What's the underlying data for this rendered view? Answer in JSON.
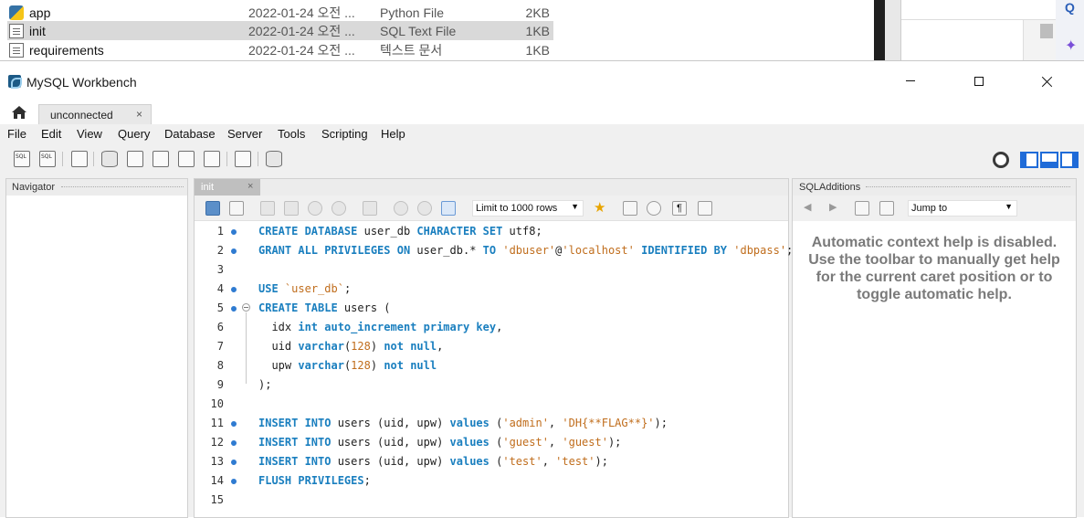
{
  "explorer": {
    "files": [
      {
        "name": "app",
        "date": "2022-01-24 오전 ...",
        "type": "Python File",
        "size": "2KB",
        "icon": "python-file-icon"
      },
      {
        "name": "init",
        "date": "2022-01-24 오전 ...",
        "type": "SQL Text File",
        "size": "1KB",
        "icon": "document-icon"
      },
      {
        "name": "requirements",
        "date": "2022-01-24 오전 ...",
        "type": "텍스트 문서",
        "size": "1KB",
        "icon": "document-icon"
      }
    ]
  },
  "window": {
    "title": "MySQL Workbench",
    "connection_tab": "unconnected",
    "tab_close": "×"
  },
  "menu": [
    "File",
    "Edit",
    "View",
    "Query",
    "Database",
    "Server",
    "Tools",
    "Scripting",
    "Help"
  ],
  "navigator": {
    "title": "Navigator"
  },
  "editor": {
    "tab_label": "init",
    "tab_close": "×",
    "limit_select": "Limit to 1000 rows",
    "lines": [
      {
        "n": "1",
        "bullet": true,
        "tokens": [
          [
            "kw",
            "CREATE DATABASE"
          ],
          [
            "t",
            " user_db "
          ],
          [
            "kw",
            "CHARACTER SET"
          ],
          [
            "t",
            " utf8;"
          ]
        ]
      },
      {
        "n": "2",
        "bullet": true,
        "tokens": [
          [
            "kw",
            "GRANT ALL PRIVILEGES ON"
          ],
          [
            "t",
            " user_db.* "
          ],
          [
            "kw",
            "TO"
          ],
          [
            "t",
            " "
          ],
          [
            "str",
            "'dbuser'"
          ],
          [
            "t",
            "@"
          ],
          [
            "str",
            "'localhost'"
          ],
          [
            "t",
            " "
          ],
          [
            "kw",
            "IDENTIFIED BY"
          ],
          [
            "t",
            " "
          ],
          [
            "str",
            "'dbpass'"
          ],
          [
            "t",
            ";"
          ]
        ]
      },
      {
        "n": "3",
        "bullet": false,
        "tokens": []
      },
      {
        "n": "4",
        "bullet": true,
        "tokens": [
          [
            "kw",
            "USE"
          ],
          [
            "t",
            " "
          ],
          [
            "str",
            "`user_db`"
          ],
          [
            "t",
            ";"
          ]
        ]
      },
      {
        "n": "5",
        "bullet": true,
        "fold": true,
        "tokens": [
          [
            "kw",
            "CREATE TABLE"
          ],
          [
            "t",
            " users ("
          ]
        ]
      },
      {
        "n": "6",
        "bullet": false,
        "tokens": [
          [
            "t",
            "  idx "
          ],
          [
            "kw",
            "int auto_increment primary key"
          ],
          [
            "t",
            ","
          ]
        ]
      },
      {
        "n": "7",
        "bullet": false,
        "tokens": [
          [
            "t",
            "  uid "
          ],
          [
            "kw",
            "varchar"
          ],
          [
            "t",
            "("
          ],
          [
            "num",
            "128"
          ],
          [
            "t",
            ") "
          ],
          [
            "kw",
            "not null"
          ],
          [
            "t",
            ","
          ]
        ]
      },
      {
        "n": "8",
        "bullet": false,
        "tokens": [
          [
            "t",
            "  upw "
          ],
          [
            "kw",
            "varchar"
          ],
          [
            "t",
            "("
          ],
          [
            "num",
            "128"
          ],
          [
            "t",
            ") "
          ],
          [
            "kw",
            "not null"
          ]
        ]
      },
      {
        "n": "9",
        "bullet": false,
        "tokens": [
          [
            "t",
            ");"
          ]
        ]
      },
      {
        "n": "10",
        "bullet": false,
        "tokens": []
      },
      {
        "n": "11",
        "bullet": true,
        "tokens": [
          [
            "kw",
            "INSERT INTO"
          ],
          [
            "t",
            " users (uid, upw) "
          ],
          [
            "kw",
            "values"
          ],
          [
            "t",
            " ("
          ],
          [
            "str",
            "'admin'"
          ],
          [
            "t",
            ", "
          ],
          [
            "str",
            "'DH{**FLAG**}'"
          ],
          [
            "t",
            ");"
          ]
        ]
      },
      {
        "n": "12",
        "bullet": true,
        "tokens": [
          [
            "kw",
            "INSERT INTO"
          ],
          [
            "t",
            " users (uid, upw) "
          ],
          [
            "kw",
            "values"
          ],
          [
            "t",
            " ("
          ],
          [
            "str",
            "'guest'"
          ],
          [
            "t",
            ", "
          ],
          [
            "str",
            "'guest'"
          ],
          [
            "t",
            ");"
          ]
        ]
      },
      {
        "n": "13",
        "bullet": true,
        "tokens": [
          [
            "kw",
            "INSERT INTO"
          ],
          [
            "t",
            " users (uid, upw) "
          ],
          [
            "kw",
            "values"
          ],
          [
            "t",
            " ("
          ],
          [
            "str",
            "'test'"
          ],
          [
            "t",
            ", "
          ],
          [
            "str",
            "'test'"
          ],
          [
            "t",
            ");"
          ]
        ]
      },
      {
        "n": "14",
        "bullet": true,
        "tokens": [
          [
            "kw",
            "FLUSH PRIVILEGES"
          ],
          [
            "t",
            ";"
          ]
        ]
      },
      {
        "n": "15",
        "bullet": false,
        "tokens": []
      }
    ]
  },
  "sql_additions": {
    "title": "SQLAdditions",
    "jump_to": "Jump to",
    "help_text": "Automatic context help is disabled. Use the toolbar to manually get help for the current caret position or to toggle automatic help."
  },
  "colors": {
    "keyword": "#1a7fbf",
    "string": "#c06d1c",
    "bullet": "#2f7bd1",
    "accent": "#1f6bd8"
  }
}
